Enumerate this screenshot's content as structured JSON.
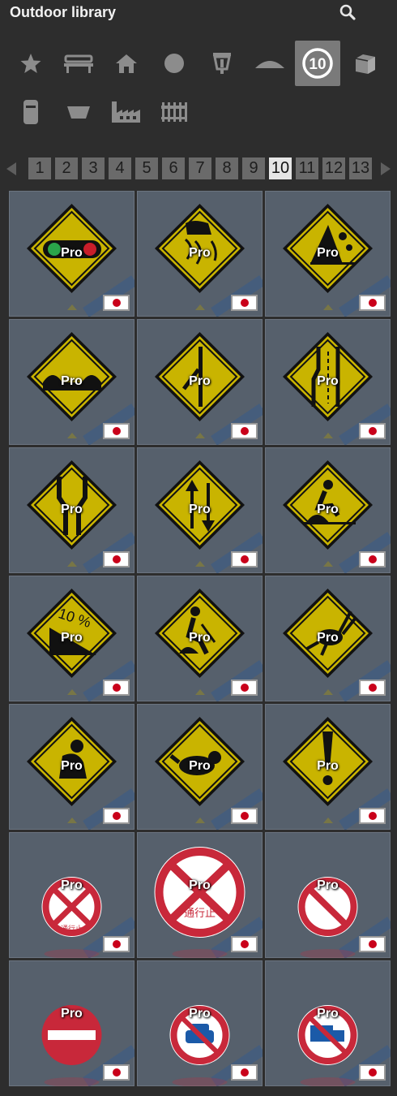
{
  "header": {
    "title": "Outdoor library",
    "search_icon": "search-icon"
  },
  "categories": [
    {
      "name": "star-icon",
      "active": false
    },
    {
      "name": "bench-icon",
      "active": false
    },
    {
      "name": "house-icon",
      "active": false
    },
    {
      "name": "circle-icon",
      "active": false
    },
    {
      "name": "street-lamp-icon",
      "active": false
    },
    {
      "name": "canopy-icon",
      "active": false
    },
    {
      "name": "traffic-sign-icon",
      "active": true,
      "label": "10"
    },
    {
      "name": "box-icon",
      "active": false
    },
    {
      "name": "bin-icon",
      "active": false
    },
    {
      "name": "planter-icon",
      "active": false
    },
    {
      "name": "factory-icon",
      "active": false
    },
    {
      "name": "fence-icon",
      "active": false
    }
  ],
  "pagination": {
    "pages": [
      "1",
      "2",
      "3",
      "4",
      "5",
      "6",
      "7",
      "8",
      "9",
      "10",
      "11",
      "12",
      "13"
    ],
    "current": "10"
  },
  "items": [
    {
      "label": "Pro",
      "icon": "traffic-light-warning-sign"
    },
    {
      "label": "Pro",
      "icon": "slippery-road-warning-sign"
    },
    {
      "label": "Pro",
      "icon": "falling-rocks-warning-sign"
    },
    {
      "label": "Pro",
      "icon": "bumpy-road-warning-sign"
    },
    {
      "label": "Pro",
      "icon": "lane-merge-warning-sign"
    },
    {
      "label": "Pro",
      "icon": "lane-reduction-warning-sign"
    },
    {
      "label": "Pro",
      "icon": "road-narrows-warning-sign"
    },
    {
      "label": "Pro",
      "icon": "two-way-traffic-warning-sign"
    },
    {
      "label": "Pro",
      "icon": "road-works-warning-sign"
    },
    {
      "label": "Pro",
      "icon": "steep-descent-warning-sign",
      "text": "10 %"
    },
    {
      "label": "Pro",
      "icon": "road-works-worker-warning-sign"
    },
    {
      "label": "Pro",
      "icon": "rabbit-crossing-warning-sign"
    },
    {
      "label": "Pro",
      "icon": "monkey-crossing-warning-sign"
    },
    {
      "label": "Pro",
      "icon": "raccoon-crossing-warning-sign"
    },
    {
      "label": "Pro",
      "icon": "caution-exclamation-warning-sign"
    },
    {
      "label": "Pro",
      "icon": "road-closed-sign",
      "text": "通行止"
    },
    {
      "label": "Pro",
      "icon": "road-closed-large-sign",
      "text": "通行止"
    },
    {
      "label": "Pro",
      "icon": "no-parking-sign"
    },
    {
      "label": "Pro",
      "icon": "no-entry-sign"
    },
    {
      "label": "Pro",
      "icon": "no-cars-sign"
    },
    {
      "label": "Pro",
      "icon": "no-trucks-sign"
    }
  ],
  "colors": {
    "background": "#2d2d2d",
    "tile": "#56606c",
    "sign_yellow": "#c9b400",
    "sign_red": "#c8283a",
    "active_category": "#7a7a7a",
    "active_page": "#e6e6e6"
  }
}
